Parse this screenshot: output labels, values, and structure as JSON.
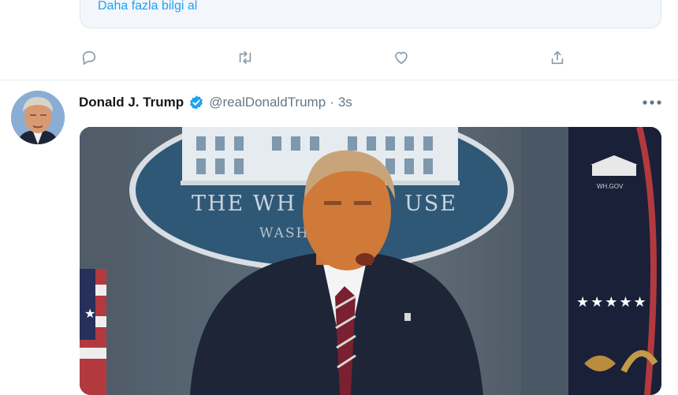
{
  "info_box": {
    "link_label": "Daha fazla bilgi al"
  },
  "tweet": {
    "author_name": "Donald J. Trump",
    "handle": "@realDonaldTrump",
    "separator": "·",
    "time": "3s",
    "media": {
      "podium_text": "THE WH",
      "podium_text_right": "USE",
      "podium_subtext": "WASH",
      "watermark": "WH.GOV"
    }
  },
  "icons": {
    "reply": "reply-icon",
    "retweet": "retweet-icon",
    "like": "heart-icon",
    "share": "share-icon",
    "verified": "verified-badge-icon",
    "more": "more-dots-icon"
  },
  "colors": {
    "accent": "#1da1f2",
    "muted": "#8899a6",
    "divider": "#e6ecf0"
  }
}
